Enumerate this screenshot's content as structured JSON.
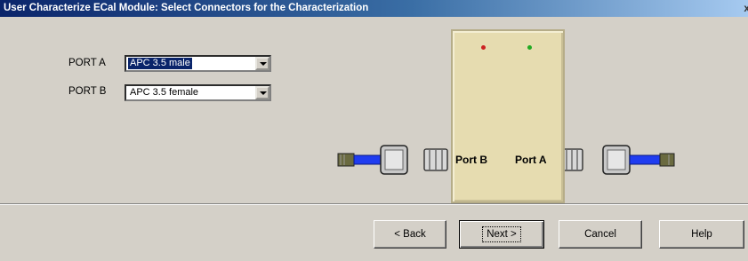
{
  "dialog": {
    "title": "User Characterize ECal Module: Select Connectors for the Characterization",
    "close_glyph": "x"
  },
  "ports": {
    "port_a": {
      "label": "PORT A",
      "value": "APC 3.5 male",
      "selected": true
    },
    "port_b": {
      "label": "PORT B",
      "value": "APC 3.5 female",
      "selected": false
    }
  },
  "module": {
    "port_b_label": "Port B",
    "port_a_label": "Port A",
    "led_left_color": "#cc2222",
    "led_right_color": "#22aa22",
    "body_color": "#e6dcb0"
  },
  "cable_color": "#1f3cf0",
  "buttons": {
    "back": "< Back",
    "next": "Next >",
    "cancel": "Cancel",
    "help": "Help"
  }
}
